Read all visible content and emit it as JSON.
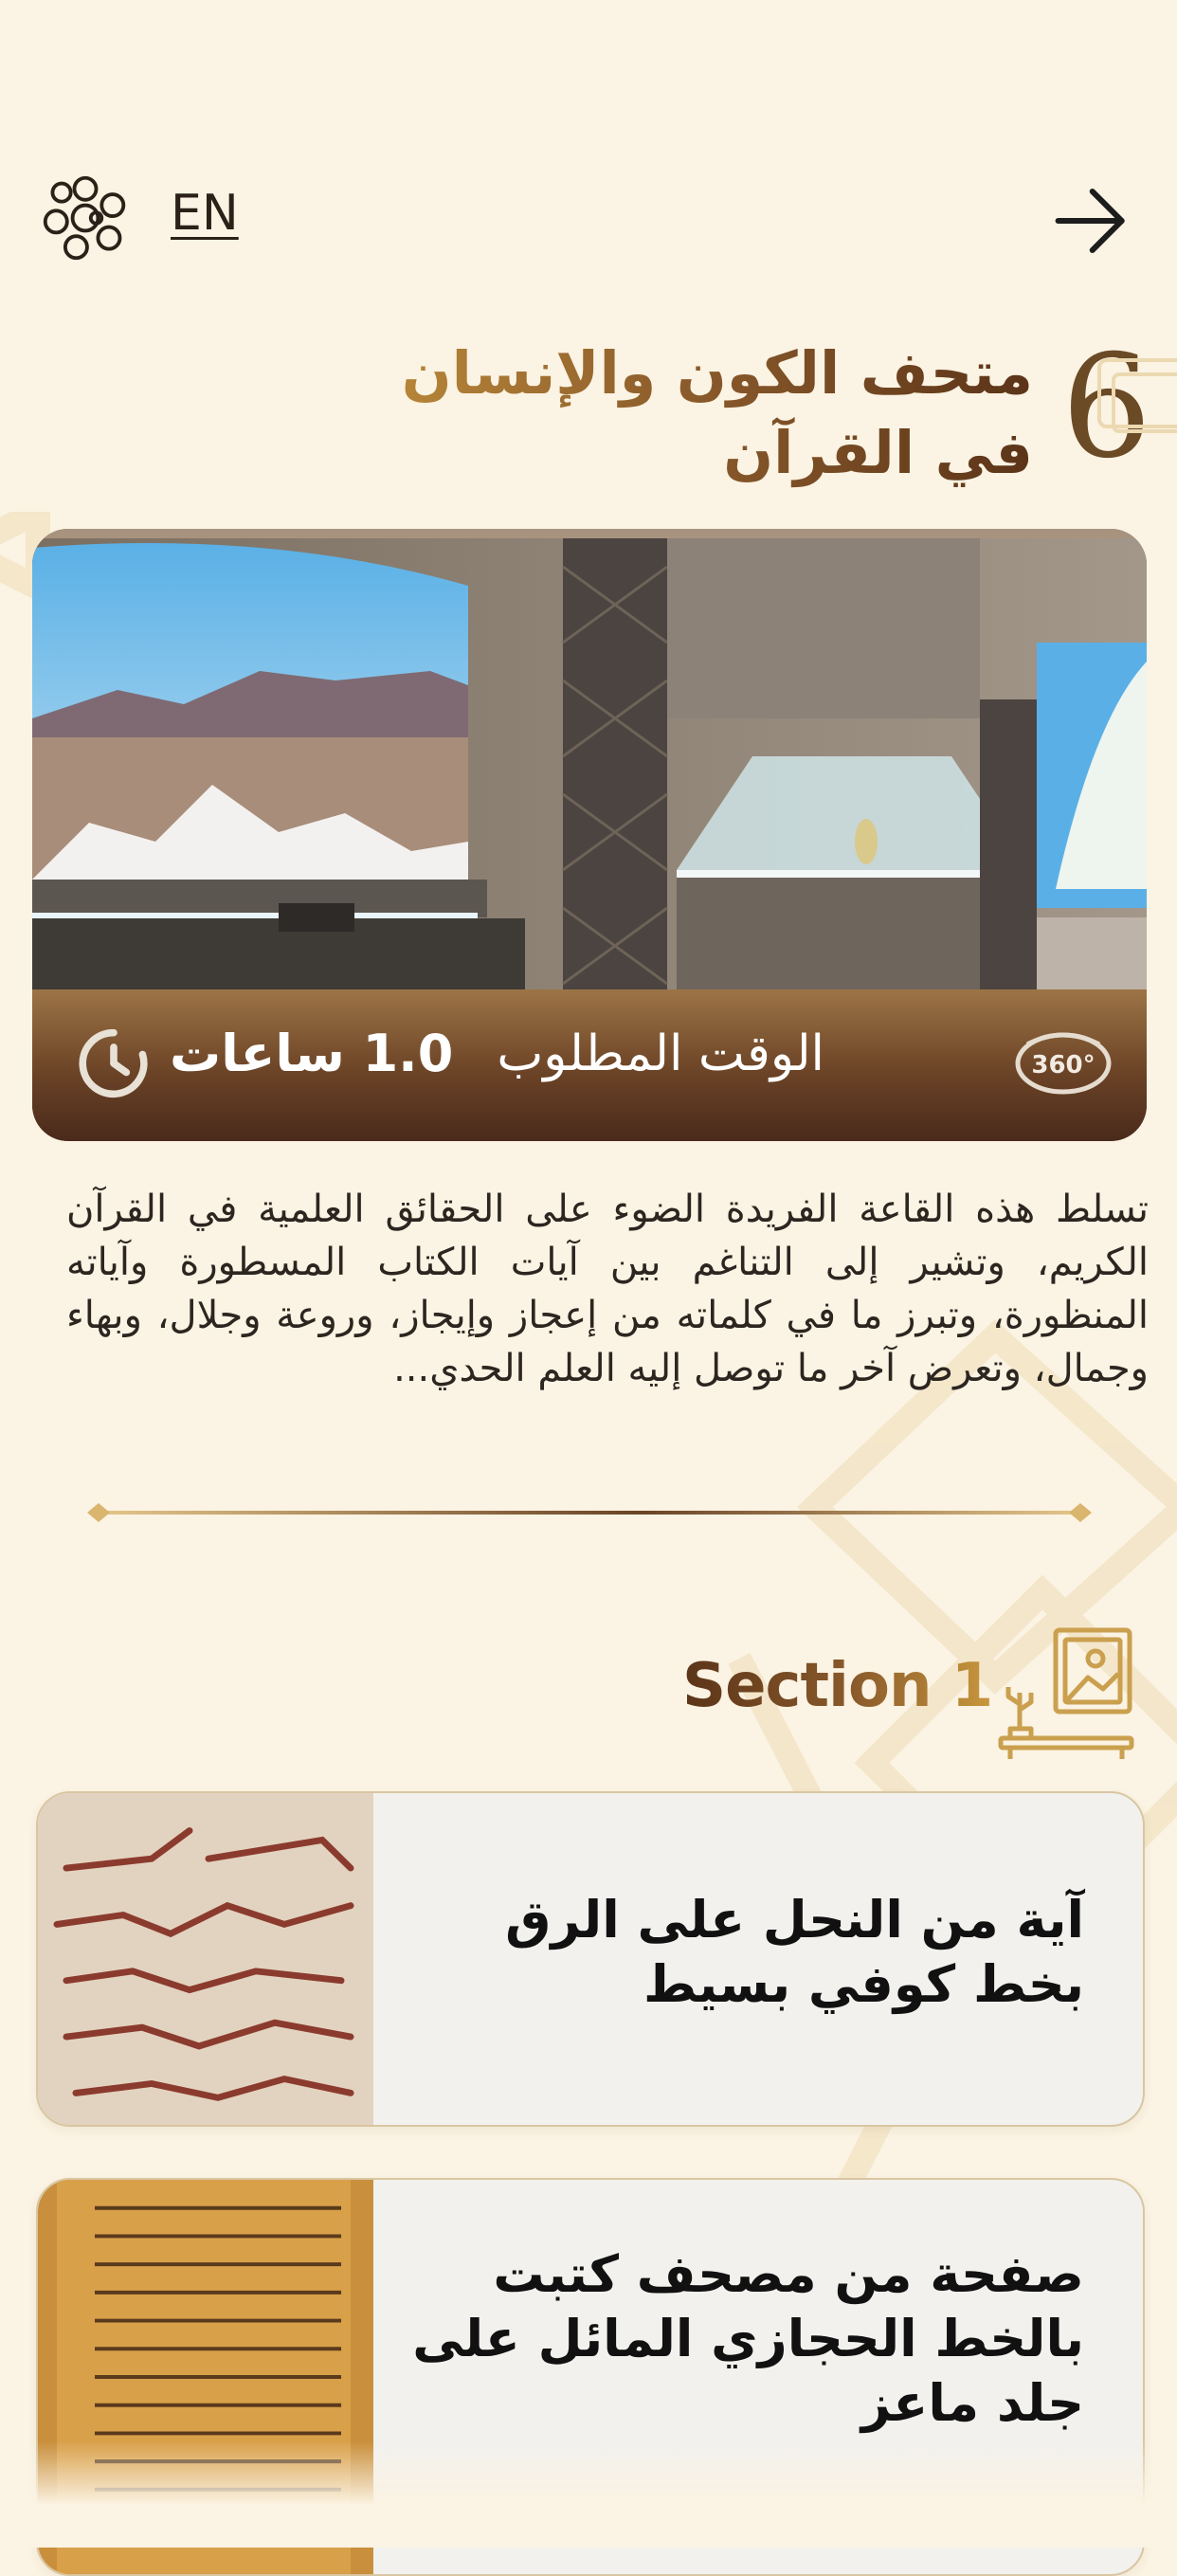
{
  "header": {
    "language_toggle": "EN",
    "logo_icon": "emblem-icon",
    "back_icon": "arrow-right-icon"
  },
  "hall": {
    "number": "6",
    "title_line1": "متحف الكون والإنسان",
    "title_line2": "في القرآن"
  },
  "hero": {
    "time_label": "الوقت المطلوب",
    "time_value": "1.0 ساعات",
    "badge_icon": "360-view-icon",
    "clock_icon": "clock-icon"
  },
  "description": "تسلط هذه القاعة الفريدة الضوء على الحقائق العلمية في القرآن الكريم، وتشير إلى التناغم بين آيات الكتاب المسطورة وآياته المنظورة، وتبرز ما في كلماته من إعجاز وإيجاز، وروعة وجلال، وبهاء وجمال، وتعرض آخر ما توصل إليه العلم الحدي...",
  "section": {
    "title": "Section 1",
    "icon": "gallery-frame-icon"
  },
  "items": [
    {
      "title": "آية من النحل على الرق بخط كوفي بسيط"
    },
    {
      "title": "صفحة من مصحف كتبت بالخط الحجازي المائل على جلد ماعز"
    }
  ],
  "colors": {
    "background": "#fbf3e3",
    "accent_gold": "#c9973d",
    "accent_brown": "#5b3418"
  }
}
